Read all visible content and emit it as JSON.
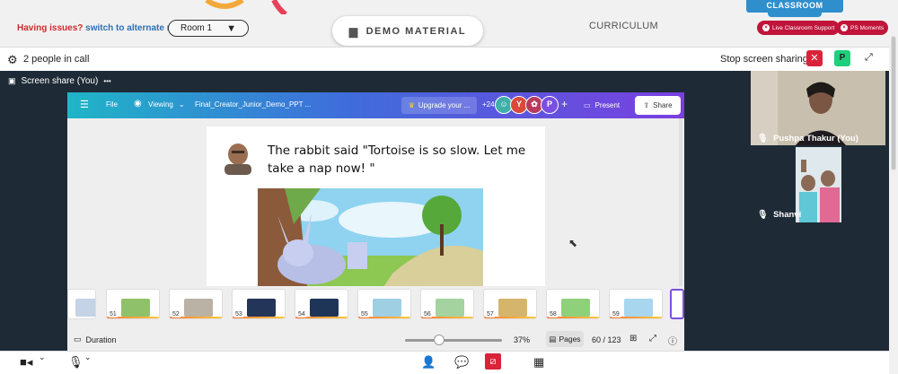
{
  "topbar": {
    "issues_question": "Having issues?",
    "issues_link": "switch to alternate room",
    "room_label": "Room 1",
    "demo_material": "DEMO MATERIAL",
    "curriculum": "CURRICULUM",
    "classroom_tab": "CLASSROOM",
    "live_support": "Live Classroom Support",
    "ps_moments": "PS Moments"
  },
  "callbar": {
    "people_count": "2 people in call",
    "stop_sharing": "Stop screen sharing",
    "self_avatar_letter": "P"
  },
  "screen_share": {
    "tab_label": "Screen share (You)",
    "tab_menu": "•••"
  },
  "canva": {
    "file": "File",
    "viewing": "Viewing",
    "doc_title": "Final_Creator_Junior_Demo_PPT ...",
    "upgrade": "Upgrade your ...",
    "collab_count": "+24",
    "avatar_y": "Y",
    "avatar_p": "P",
    "plus": "+",
    "present": "Present",
    "share": "Share",
    "slide_text": "The rabbit said \"Tortoise is so slow. Let me take a nap now! \"",
    "duration": "Duration",
    "zoom": "37%",
    "pages": "Pages",
    "page_count": "60 / 123",
    "thumbnails": [
      {
        "num": "51",
        "color": "#8fc16a"
      },
      {
        "num": "52",
        "color": "#b9b2a5"
      },
      {
        "num": "53",
        "color": "#23365a"
      },
      {
        "num": "54",
        "color": "#1f3558"
      },
      {
        "num": "55",
        "color": "#9fcfe3"
      },
      {
        "num": "56",
        "color": "#a5d3a0"
      },
      {
        "num": "57",
        "color": "#d5b56b"
      },
      {
        "num": "58",
        "color": "#8fd17a"
      },
      {
        "num": "59",
        "color": "#a7d6ee"
      }
    ]
  },
  "participants": [
    {
      "name": "Pushpa Thakur (You)"
    },
    {
      "name": "Shanvi"
    }
  ]
}
